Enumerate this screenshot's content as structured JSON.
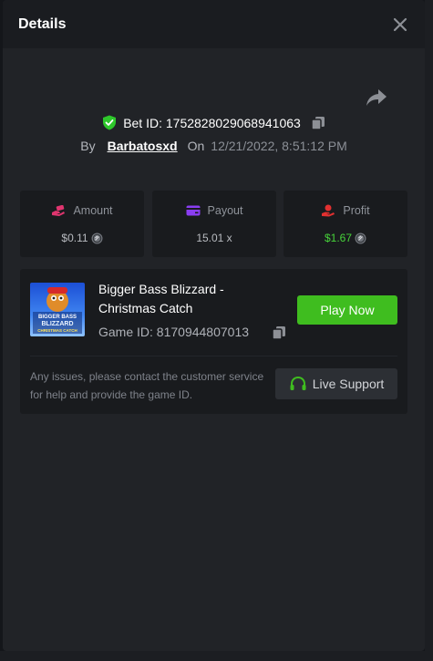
{
  "header": {
    "title": "Details",
    "close_icon": "close-icon"
  },
  "bet": {
    "id_label": "Bet ID: 1752828029068941063",
    "by_label": "By",
    "user": "Barbatosxd",
    "on_label": "On",
    "date": "12/21/2022, 8:51:12 PM"
  },
  "stats": {
    "amount": {
      "label": "Amount",
      "value": "$0.11",
      "icon": "money-hand-icon",
      "color": "#e0356f"
    },
    "payout": {
      "label": "Payout",
      "value": "15.01 x",
      "icon": "card-icon",
      "color": "#8a3df2"
    },
    "profit": {
      "label": "Profit",
      "value": "$1.67",
      "icon": "profit-hand-icon",
      "color": "#e23030"
    }
  },
  "game": {
    "name": "Bigger Bass Blizzard - Christmas Catch",
    "id_label": "Game ID: 8170944807013",
    "thumb_text_1": "BIGGER BASS",
    "thumb_text_2": "BLIZZARD",
    "thumb_text_3": "CHRISTMAS CATCH",
    "play_label": "Play Now",
    "issue_text": "Any issues, please contact the customer service for help and provide the game ID.",
    "support_label": "Live Support"
  },
  "colors": {
    "accent_green": "#3fbd1f",
    "profit_green": "#47d33a",
    "shield_green": "#2ec72b"
  }
}
